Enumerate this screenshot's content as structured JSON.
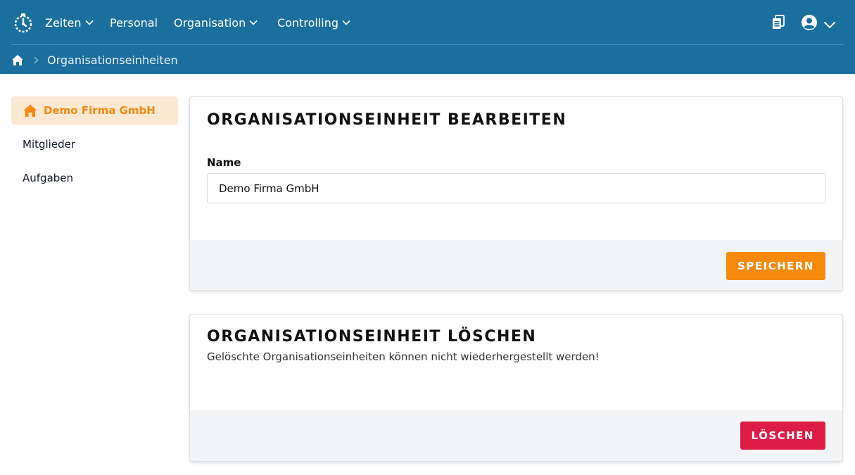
{
  "nav": {
    "items": [
      {
        "label": "Zeiten",
        "has_dropdown": true
      },
      {
        "label": "Personal",
        "has_dropdown": false
      },
      {
        "label": "Organisation",
        "has_dropdown": true
      },
      {
        "label": "Controlling",
        "has_dropdown": true
      }
    ]
  },
  "breadcrumb": {
    "current": "Organisationseinheiten"
  },
  "sidebar": {
    "items": [
      {
        "label": "Demo Firma GmbH",
        "active": true
      },
      {
        "label": "Mitglieder",
        "active": false
      },
      {
        "label": "Aufgaben",
        "active": false
      }
    ]
  },
  "edit_card": {
    "title": "ORGANISATIONSEINHEIT BEARBEITEN",
    "name_label": "Name",
    "name_value": "Demo Firma GmbH",
    "save_label": "SPEICHERN"
  },
  "delete_card": {
    "title": "ORGANISATIONSEINHEIT LÖSCHEN",
    "description": "Gelöschte Organisationseinheiten können nicht wiederhergestellt werden!",
    "delete_label": "LÖSCHEN"
  },
  "colors": {
    "header_bg": "#1a6f9e",
    "accent_orange": "#f7890c",
    "danger_red": "#de1c48",
    "active_bg": "#fde8d3"
  }
}
